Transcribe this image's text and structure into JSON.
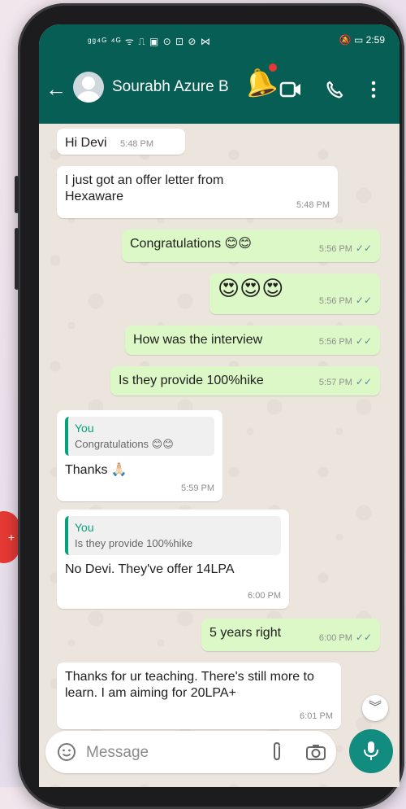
{
  "status_bar": {
    "signal": "ᵍᵍ⁴ᴳ ⁴ᴳ ᯤ ⎍ ▣ ⊙ ⊡ ⊘ ⋈",
    "battery_time": "🔕 ▭ 2:59"
  },
  "header": {
    "contact_name": "Sourabh Azure B"
  },
  "messages": [
    {
      "text": "Hi Devi",
      "time": "5:48 PM"
    },
    {
      "text": "I just got an offer letter from Hexaware",
      "time": "5:48 PM"
    },
    {
      "text": "Congratulations 😊😊",
      "time": "5:56 PM"
    },
    {
      "text": "😍😍😍",
      "time": "5:56 PM"
    },
    {
      "text": "How was the interview",
      "time": "5:56 PM"
    },
    {
      "text": "Is they provide 100%hike",
      "time": "5:57 PM"
    },
    {
      "quote_author": "You",
      "quote_text": "Congratulations 😊😊",
      "text": "Thanks 🙏🏻",
      "time": "5:59 PM"
    },
    {
      "quote_author": "You",
      "quote_text": "Is they provide 100%hike",
      "text": "No Devi. They've offer 14LPA",
      "time": "6:00 PM"
    },
    {
      "text": "5 years right",
      "time": "6:00 PM"
    },
    {
      "text": "Thanks for ur teaching. There's still more to learn.  I am aiming for 20LPA+",
      "time": "6:01 PM"
    }
  ],
  "composer": {
    "placeholder": "Message"
  },
  "side_badge": "+",
  "nav": {
    "back": "◁",
    "home": "○",
    "recents": "□"
  },
  "colors": {
    "header": "#075e54",
    "outgoing": "#dcf8c6",
    "incoming": "#ffffff",
    "accent": "#128c7e"
  }
}
